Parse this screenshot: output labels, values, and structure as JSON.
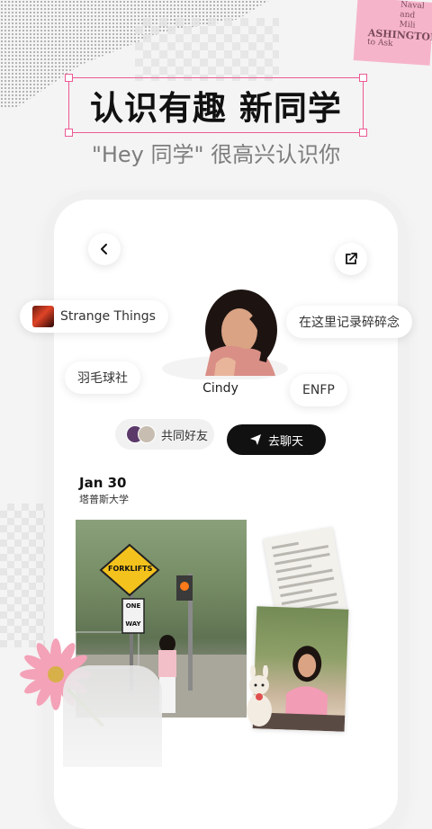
{
  "headline": "认识有趣 新同学",
  "subtitle": "\"Hey 同学\" 很高兴认识你",
  "profile": {
    "name": "Cindy",
    "tags": {
      "show": "Strange Things",
      "note": "在这里记录碎碎念",
      "club": "羽毛球社",
      "mbti": "ENFP"
    },
    "mutual_friends_label": "共同好友",
    "chat_button_label": "去聊天"
  },
  "post": {
    "date": "Jan 30",
    "location": "塔普斯大学",
    "sign_forklifts": "FORKLIFTS",
    "sign_one": "ONE",
    "sign_way": "WAY"
  },
  "deco": {
    "news_lines": [
      "Naval and Mili",
      "ASHINGTON",
      "to Ask"
    ]
  },
  "colors": {
    "accent_pink": "#ec5a93",
    "button_dark": "#111111"
  },
  "icons": {
    "back": "chevron-left-icon",
    "share": "share-icon",
    "send": "send-icon"
  }
}
